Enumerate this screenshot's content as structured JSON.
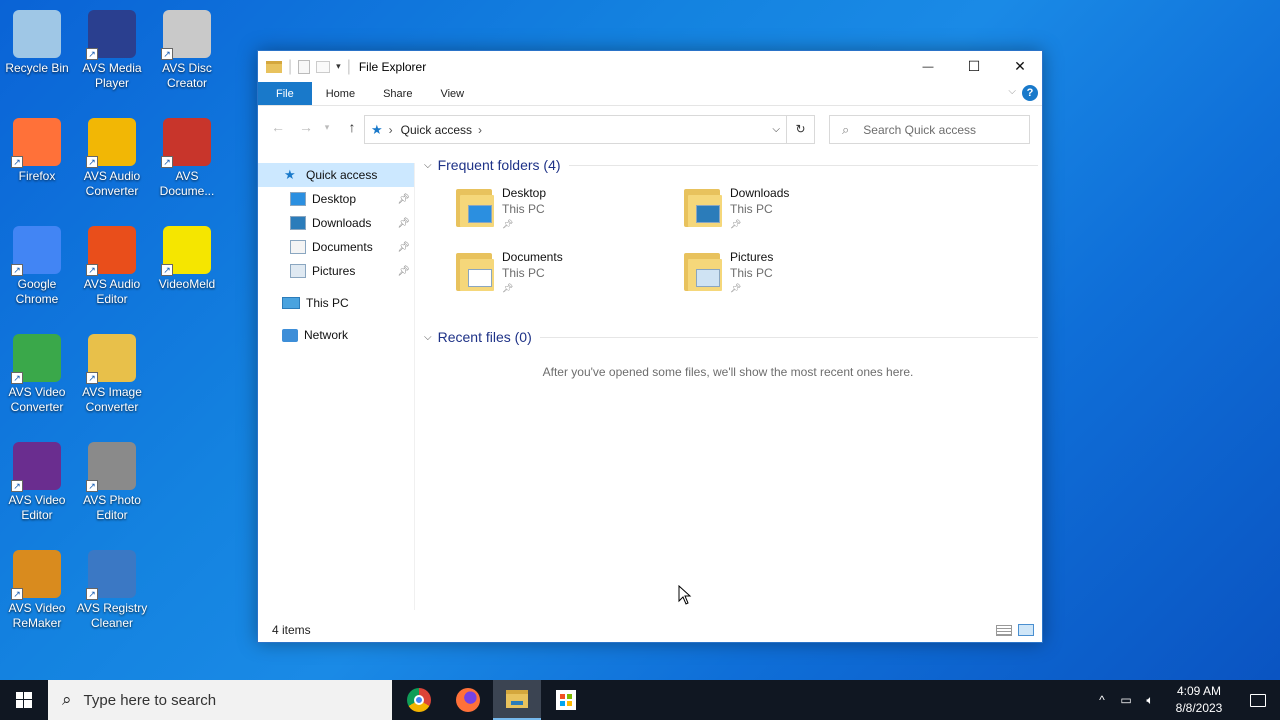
{
  "desktop_icons": [
    {
      "id": "recycle-bin",
      "label": "Recycle Bin",
      "icon": "recycle-bin-icon",
      "color": "#9fc7e6"
    },
    {
      "id": "avs-media-player",
      "label": "AVS Media Player",
      "icon": "avs-media-player-icon",
      "color": "#2a3f8f"
    },
    {
      "id": "avs-disc-creator",
      "label": "AVS Disc Creator",
      "icon": "avs-disc-creator-icon",
      "color": "#c9c9c9"
    },
    {
      "id": "firefox",
      "label": "Firefox",
      "icon": "firefox-icon",
      "color": "#ff7139"
    },
    {
      "id": "avs-audio-converter",
      "label": "AVS Audio Converter",
      "icon": "avs-audio-converter-icon",
      "color": "#f2b705"
    },
    {
      "id": "avs-document",
      "label": "AVS Docume...",
      "icon": "avs-document-converter-icon",
      "color": "#c8352b"
    },
    {
      "id": "google-chrome",
      "label": "Google Chrome",
      "icon": "chrome-icon",
      "color": "#4285f4"
    },
    {
      "id": "avs-audio-editor",
      "label": "AVS Audio Editor",
      "icon": "avs-audio-editor-icon",
      "color": "#e94e1b"
    },
    {
      "id": "videomeld",
      "label": "VideoMeld",
      "icon": "videomeld-icon",
      "color": "#f5e600"
    },
    {
      "id": "avs-video-converter",
      "label": "AVS Video Converter",
      "icon": "avs-video-converter-icon",
      "color": "#3aa84a"
    },
    {
      "id": "avs-image-converter",
      "label": "AVS Image Converter",
      "icon": "avs-image-converter-icon",
      "color": "#e8c04a"
    },
    {
      "id": "avs-video-editor",
      "label": "AVS Video Editor",
      "icon": "avs-video-editor-icon",
      "color": "#6a2d8f"
    },
    {
      "id": "avs-photo-editor",
      "label": "AVS Photo Editor",
      "icon": "avs-photo-editor-icon",
      "color": "#8a8a8a"
    },
    {
      "id": "avs-video-remaker",
      "label": "AVS Video ReMaker",
      "icon": "avs-video-remaker-icon",
      "color": "#d98b1e"
    },
    {
      "id": "avs-registry-cleaner",
      "label": "AVS Registry Cleaner",
      "icon": "avs-registry-cleaner-icon",
      "color": "#3b78c4"
    }
  ],
  "window": {
    "title": "File Explorer",
    "minimize_glyph": "—",
    "maximize_glyph": "☐",
    "close_glyph": "✕"
  },
  "ribbon": {
    "tabs": [
      "File",
      "Home",
      "Share",
      "View"
    ],
    "help_glyph": "?"
  },
  "address": {
    "back_glyph": "←",
    "forward_glyph": "→",
    "up_glyph": "↑",
    "path": "Quick access",
    "refresh_glyph": "↻",
    "search_placeholder": "Search Quick access"
  },
  "nav": {
    "quick_access": "Quick access",
    "pinned": [
      {
        "label": "Desktop",
        "icon": "desktop-icon"
      },
      {
        "label": "Downloads",
        "icon": "downloads-icon"
      },
      {
        "label": "Documents",
        "icon": "documents-icon"
      },
      {
        "label": "Pictures",
        "icon": "pictures-icon"
      }
    ],
    "this_pc": "This PC",
    "network": "Network"
  },
  "content": {
    "frequent_header": "Frequent folders (4)",
    "folders": [
      {
        "name": "Desktop",
        "location": "This PC",
        "overlay": "desktop"
      },
      {
        "name": "Downloads",
        "location": "This PC",
        "overlay": "downloads"
      },
      {
        "name": "Documents",
        "location": "This PC",
        "overlay": "documents"
      },
      {
        "name": "Pictures",
        "location": "This PC",
        "overlay": "pictures"
      }
    ],
    "recent_header": "Recent files (0)",
    "recent_empty": "After you've opened some files, we'll show the most recent ones here."
  },
  "status": {
    "items": "4 items"
  },
  "taskbar": {
    "search_placeholder": "Type here to search",
    "time": "4:09 AM",
    "date": "8/8/2023"
  }
}
